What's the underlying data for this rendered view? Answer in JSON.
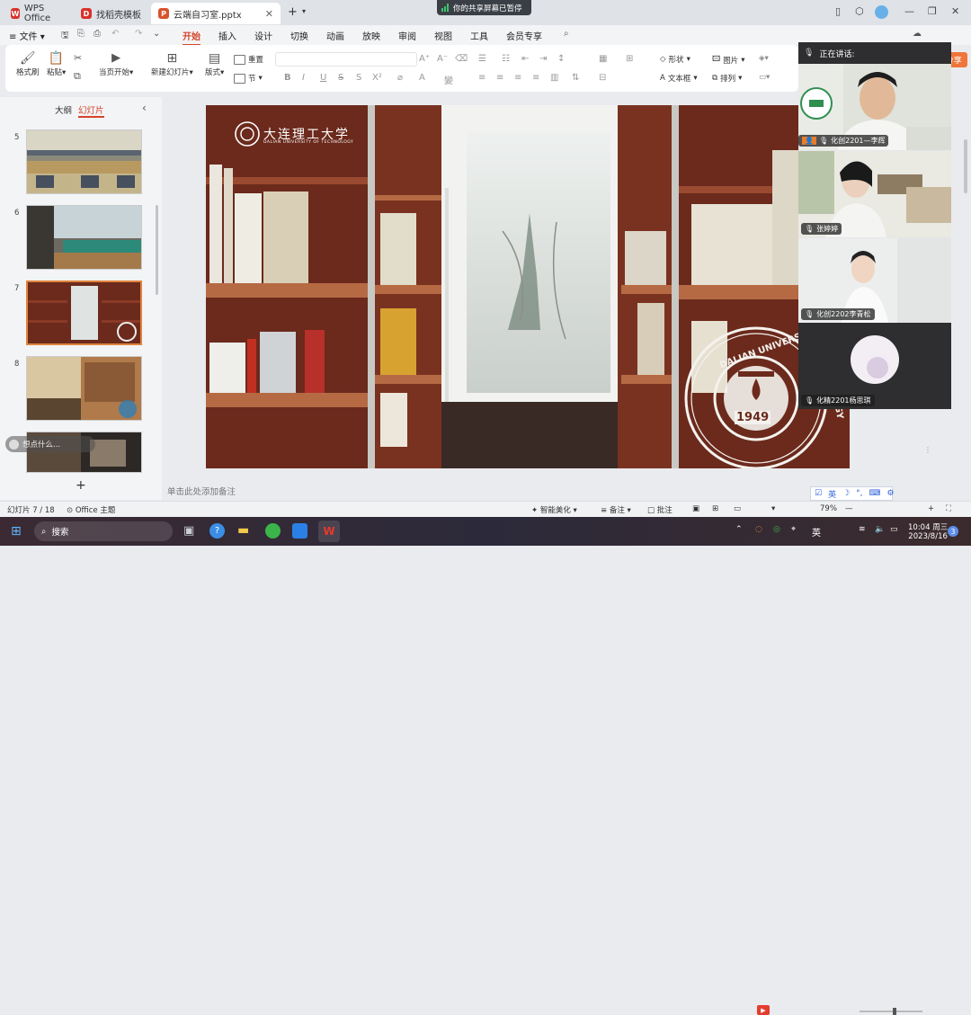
{
  "tabs": [
    {
      "label": "WPS Office",
      "icon": "wps-icon",
      "color": "#d8322a"
    },
    {
      "label": "找稻壳模板",
      "icon": "docer-icon",
      "color": "#d8322a"
    },
    {
      "label": "云端自习室.pptx",
      "icon": "ppt-file-icon",
      "color": "#d8522a"
    }
  ],
  "share_banner": "你的共享屏幕已暂停",
  "file_menu": "文件",
  "menus": [
    "开始",
    "插入",
    "设计",
    "切换",
    "动画",
    "放映",
    "审阅",
    "视图",
    "工具",
    "会员专享"
  ],
  "share_button": "分享",
  "ribbon": {
    "format_painter": "格式刷",
    "paste": "粘贴",
    "from_current": "当页开始",
    "new_slide": "新建幻灯片",
    "layout": "版式",
    "reset": "重置",
    "section": "节",
    "shape": "形状",
    "picture": "图片",
    "textbox": "文本框",
    "arrange": "排列"
  },
  "leftpane": {
    "outline_tab": "大纲",
    "slides_tab": "幻灯片",
    "ai_hint": "想点什么..."
  },
  "thumbnails": [
    {
      "num": "5"
    },
    {
      "num": "6"
    },
    {
      "num": "7"
    },
    {
      "num": "8"
    },
    {
      "num": ""
    }
  ],
  "slide": {
    "univ_name": "大连理工大学",
    "univ_en": "DALIAN UNIVERSITY OF TECHNOLOGY",
    "seal_year": "1949",
    "seal_text_left": "DALIAN UNIVERSITY OF",
    "seal_text_right": "GY"
  },
  "notes_placeholder": "单击此处添加备注",
  "video": {
    "speaking_label": "正在讲话:",
    "participants": [
      {
        "name": "化创2201—李辉"
      },
      {
        "name": "张婷婷"
      },
      {
        "name": "化创2202李青松"
      },
      {
        "name": "化精2201杨思琪"
      }
    ]
  },
  "ime_toolbar": {
    "lang": "英"
  },
  "statusbar": {
    "slide_counter": "幻灯片 7 / 18",
    "theme": "Office 主题",
    "smart_beautify": "智能美化",
    "notes": "备注",
    "comments": "批注",
    "zoom": "79%"
  },
  "taskbar": {
    "search": "搜索",
    "lang": "英",
    "time": "10:04 周三",
    "date": "2023/8/16",
    "notif": "3"
  }
}
